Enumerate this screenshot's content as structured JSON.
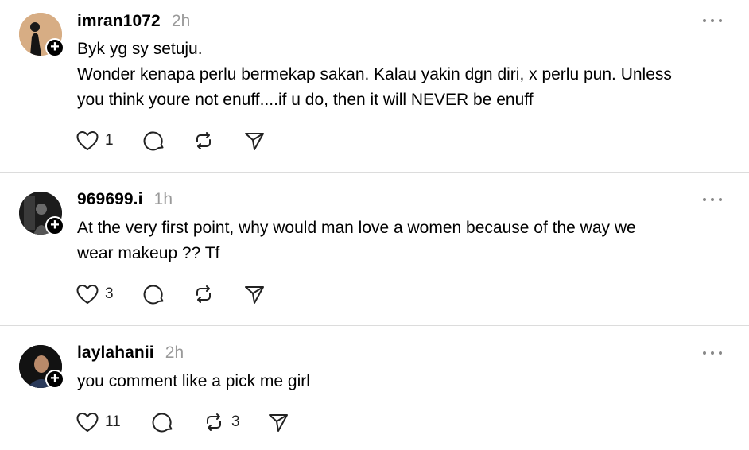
{
  "posts": [
    {
      "username": "imran1072",
      "time": "2h",
      "lines": [
        "Byk yg sy setuju.",
        "Wonder kenapa perlu bermekap sakan. Kalau yakin dgn diri, x perlu pun. Unless",
        "you think youre not enuff....if u do, then it will NEVER be enuff"
      ],
      "likes": "1",
      "reposts": ""
    },
    {
      "username": "969699.i",
      "time": "1h",
      "lines": [
        "At the very first point, why would man love a women because of the way we",
        "wear makeup ?? Tf"
      ],
      "likes": "3",
      "reposts": ""
    },
    {
      "username": "laylahanii",
      "time": "2h",
      "lines": [
        "you comment like a pick me girl"
      ],
      "likes": "11",
      "reposts": "3"
    }
  ],
  "icons": {
    "like": "heart-icon",
    "reply": "comment-icon",
    "repost": "repost-icon",
    "share": "send-icon",
    "more": "more-icon",
    "follow": "plus-icon"
  }
}
